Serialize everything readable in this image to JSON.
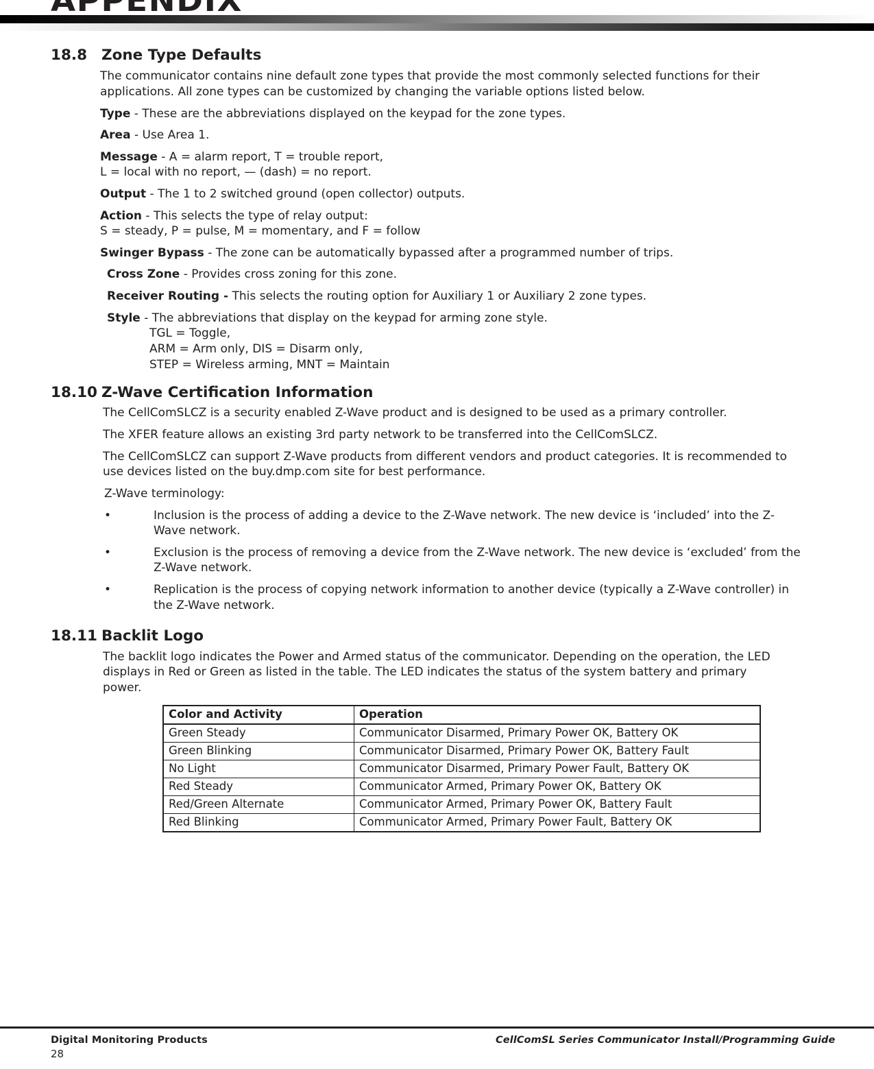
{
  "header": {
    "appendix_label": "APPENDIX"
  },
  "sections": {
    "zone_type_defaults": {
      "number": "18.8",
      "title": "Zone Type Defaults",
      "intro": "The communicator contains nine default zone types that provide the most commonly selected functions for their applications. All zone types can be customized by changing the variable options listed below.",
      "items": [
        {
          "term": "Type",
          "text": " - These are the abbreviations displayed on the keypad for the zone types."
        },
        {
          "term": "Area",
          "text": " - Use Area 1."
        },
        {
          "term": "Message",
          "text": " - A = alarm report, T = trouble report,"
        },
        {
          "term": "Output",
          "text": " - The 1 to 2 switched ground (open collector) outputs."
        },
        {
          "term": "Action",
          "text": " - This selects the type of relay output:"
        },
        {
          "term": "Swinger Bypass",
          "text": " - The zone can be automatically bypassed after a programmed number of trips."
        },
        {
          "term": "Cross Zone",
          "text": " - Provides cross zoning for this zone."
        },
        {
          "term": "Receiver Routing -",
          "text": " This selects the routing option for Auxiliary 1 or Auxiliary 2 zone types."
        },
        {
          "term": "Style",
          "text": " - The abbreviations that display on the keypad for arming zone style."
        }
      ],
      "message_line2": "L = local with no report, — (dash) = no report.",
      "action_line2": "S = steady, P = pulse, M = momentary, and F = follow",
      "style_lines": [
        "TGL = Toggle,",
        "ARM = Arm only, DIS = Disarm only,",
        "STEP = Wireless arming, MNT = Maintain"
      ]
    },
    "zwave_certification": {
      "number": "18.10",
      "title": "Z-Wave Certiﬁcation Information",
      "paragraphs": [
        "The CellComSLCZ is a security enabled Z-Wave product and is designed to be used as a primary controller.",
        "The XFER feature allows an existing 3rd party network to be transferred into the CellComSLCZ.",
        "The CellComSLCZ can support Z-Wave products from different vendors and product categories. It is recommended to use devices listed on the buy.dmp.com site for best performance."
      ],
      "terminology_label": "Z-Wave terminology:",
      "bullet_glyph": "•",
      "bullets": [
        "Inclusion is the process of adding a device to the Z-Wave network. The new device is ‘included’ into the Z-Wave network.",
        "Exclusion is the process of removing a device from the Z-Wave network. The new device is ‘excluded’ from the Z-Wave network.",
        "Replication is the process of copying network information to another device (typically a Z-Wave controller) in the Z-Wave network."
      ]
    },
    "backlit_logo": {
      "number": "18.11",
      "title": "Backlit Logo",
      "intro": "The backlit logo indicates the Power and Armed status of the communicator. Depending on the operation, the LED displays in Red or Green as listed in the table. The LED indicates the status of the system battery and primary power.",
      "table": {
        "columns": [
          "Color and Activity",
          "Operation"
        ],
        "rows": [
          [
            "Green Steady",
            "Communicator Disarmed, Primary Power OK, Battery OK"
          ],
          [
            "Green Blinking",
            "Communicator Disarmed, Primary Power OK, Battery Fault"
          ],
          [
            "No Light",
            "Communicator Disarmed, Primary Power Fault, Battery OK"
          ],
          [
            "Red Steady",
            "Communicator Armed, Primary Power OK, Battery OK"
          ],
          [
            "Red/Green Alternate",
            "Communicator Armed, Primary Power OK, Battery Fault"
          ],
          [
            "Red Blinking",
            "Communicator Armed, Primary Power Fault, Battery OK"
          ]
        ]
      }
    }
  },
  "footer": {
    "company": "Digital Monitoring Products",
    "page_number": "28",
    "guide_title": "CellComSL Series Communicator Install/Programming Guide"
  }
}
